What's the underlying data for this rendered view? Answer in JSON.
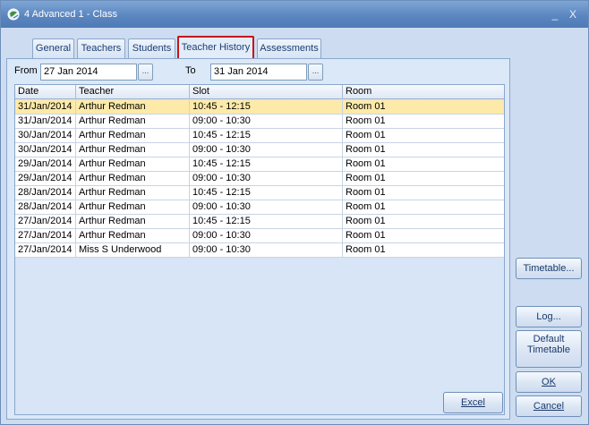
{
  "window": {
    "title": "4 Advanced 1 - Class",
    "minimize_glyph": "_",
    "close_glyph": "X"
  },
  "tabs": [
    {
      "label": "General"
    },
    {
      "label": "Teachers"
    },
    {
      "label": "Students"
    },
    {
      "label": "Teacher History"
    },
    {
      "label": "Assessments"
    }
  ],
  "active_tab": "Teacher History",
  "filters": {
    "from_label": "From",
    "from_value": "27 Jan 2014",
    "to_label": "To",
    "to_value": "31 Jan 2014",
    "picker_glyph": "..."
  },
  "table": {
    "columns": [
      "Date",
      "Teacher",
      "Slot",
      "Room"
    ],
    "rows": [
      [
        "31/Jan/2014",
        "Arthur Redman",
        "10:45 - 12:15",
        "Room 01"
      ],
      [
        "31/Jan/2014",
        "Arthur Redman",
        "09:00 - 10:30",
        "Room 01"
      ],
      [
        "30/Jan/2014",
        "Arthur Redman",
        "10:45 - 12:15",
        "Room 01"
      ],
      [
        "30/Jan/2014",
        "Arthur Redman",
        "09:00 - 10:30",
        "Room 01"
      ],
      [
        "29/Jan/2014",
        "Arthur Redman",
        "10:45 - 12:15",
        "Room 01"
      ],
      [
        "29/Jan/2014",
        "Arthur Redman",
        "09:00 - 10:30",
        "Room 01"
      ],
      [
        "28/Jan/2014",
        "Arthur Redman",
        "10:45 - 12:15",
        "Room 01"
      ],
      [
        "28/Jan/2014",
        "Arthur Redman",
        "09:00 - 10:30",
        "Room 01"
      ],
      [
        "27/Jan/2014",
        "Arthur Redman",
        "10:45 - 12:15",
        "Room 01"
      ],
      [
        "27/Jan/2014",
        "Arthur Redman",
        "09:00 - 10:30",
        "Room 01"
      ],
      [
        "27/Jan/2014",
        "Miss S Underwood",
        "09:00 - 10:30",
        "Room 01"
      ]
    ]
  },
  "buttons": {
    "excel": "Excel",
    "timetable": "Timetable...",
    "log": "Log...",
    "default_timetable_line1": "Default",
    "default_timetable_line2": "Timetable",
    "ok": "OK",
    "cancel": "Cancel"
  },
  "colors": {
    "selected_row": "#fdeaa8",
    "active_tab_border": "#c4151c",
    "titlebar": "#5b86c0"
  }
}
